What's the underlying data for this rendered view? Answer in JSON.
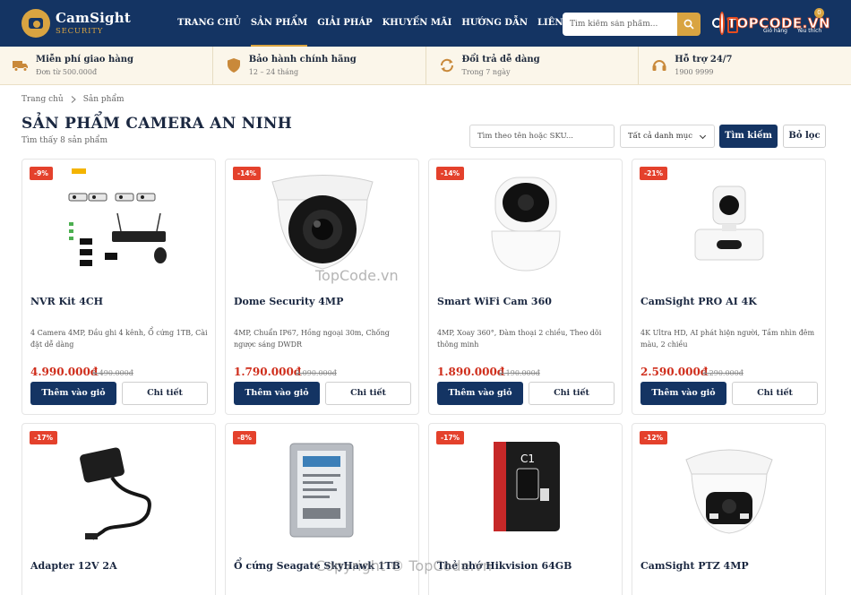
{
  "header": {
    "brand": "CamSight",
    "brand_sub": "SECURITY",
    "nav": [
      "TRANG CHỦ",
      "SẢN PHẨM",
      "GIẢI PHÁP",
      "KHUYẾN MÃI",
      "HƯỚNG DẪN",
      "LIÊN HỆ"
    ],
    "search_placeholder": "Tìm kiếm sản phẩm...",
    "cart_label": "Giỏ hàng",
    "fav_label": "Yêu thích",
    "fav_count": "0",
    "watermark": "TOPCODE.VN",
    "accent": "#d9a441",
    "bg": "#143463"
  },
  "features": [
    {
      "icon": "truck-icon",
      "title": "Miễn phí giao hàng",
      "sub": "Đơn từ 500.000đ"
    },
    {
      "icon": "shield-icon",
      "title": "Bảo hành chính hãng",
      "sub": "12 – 24 tháng"
    },
    {
      "icon": "refresh-icon",
      "title": "Đổi trả dễ dàng",
      "sub": "Trong 7 ngày"
    },
    {
      "icon": "headset-icon",
      "title": "Hỗ trợ 24/7",
      "sub": "1900 9999"
    }
  ],
  "breadcrumb": [
    "Trang chủ",
    "Sản phẩm"
  ],
  "page": {
    "title": "SẢN PHẨM CAMERA AN NINH",
    "count": "Tìm thấy 8 sản phẩm"
  },
  "filter": {
    "placeholder": "Tìm theo tên hoặc SKU...",
    "category": "Tất cả danh mục",
    "search_label": "Tìm kiếm",
    "reset_label": "Bỏ lọc"
  },
  "products": [
    {
      "name": "NVR Kit 4CH",
      "badge": "-9%",
      "desc": "4 Camera 4MP, Đầu ghi 4 kênh, Ổ cứng 1TB, Cài đặt dễ dàng",
      "price": "4.990.000đ",
      "old": "5.490.000đ",
      "add": "Thêm vào giỏ",
      "detail": "Chi tiết",
      "image": "nvr-kit-image"
    },
    {
      "name": "Dome Security 4MP",
      "badge": "-14%",
      "desc": "4MP, Chuẩn IP67, Hồng ngoại 30m, Chống ngược sáng DWDR",
      "price": "1.790.000đ",
      "old": "2.090.000đ",
      "add": "Thêm vào giỏ",
      "detail": "Chi tiết",
      "image": "dome-camera-image"
    },
    {
      "name": "Smart WiFi Cam 360",
      "badge": "-14%",
      "desc": "4MP, Xoay 360°, Đàm thoại 2 chiều, Theo dõi thông minh",
      "price": "1.890.000đ",
      "old": "2.190.000đ",
      "add": "Thêm vào giỏ",
      "detail": "Chi tiết",
      "image": "wifi-cam-image"
    },
    {
      "name": "CamSight PRO AI 4K",
      "badge": "-21%",
      "desc": "4K Ultra HD, AI phát hiện người, Tầm nhìn đêm màu, 2 chiều",
      "price": "2.590.000đ",
      "old": "3.290.000đ",
      "add": "Thêm vào giỏ",
      "detail": "Chi tiết",
      "image": "pro-ai-cam-image"
    },
    {
      "name": "Adapter 12V 2A",
      "badge": "-17%",
      "image": "adapter-image"
    },
    {
      "name": "Ổ cứng Seagate SkyHawk 1TB",
      "badge": "-8%",
      "image": "hdd-image"
    },
    {
      "name": "Thẻ nhớ Hikvision 64GB",
      "badge": "-17%",
      "image": "sd-card-image"
    },
    {
      "name": "CamSight PTZ 4MP",
      "badge": "-12%",
      "image": "ptz-cam-image"
    }
  ],
  "overlays": {
    "top": "TopCode.vn",
    "bottom": "Copyright © TopCode.vn"
  }
}
